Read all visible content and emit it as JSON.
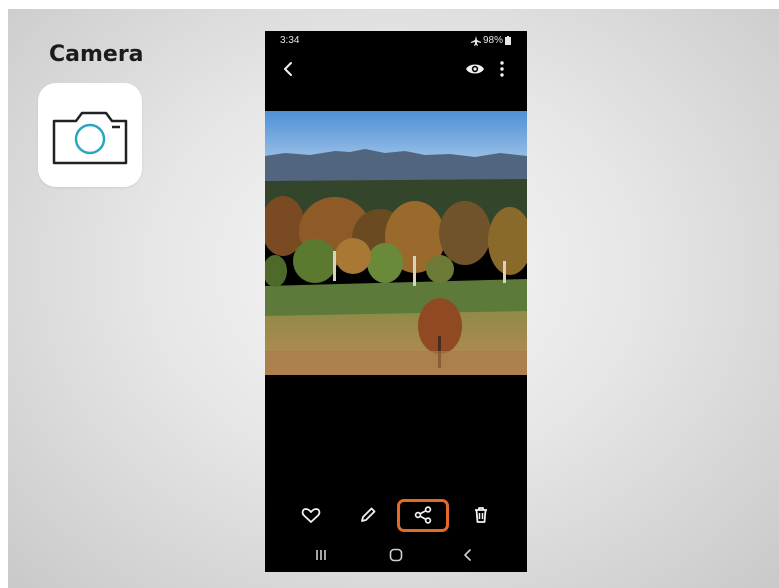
{
  "app": {
    "title": "Camera"
  },
  "status_bar": {
    "time": "3:34",
    "battery": "98%"
  },
  "colors": {
    "highlight": "#e36a2b",
    "icon_accent": "#2aa7c0"
  },
  "icons": {
    "camera": "camera-icon",
    "back": "back-arrow-icon",
    "view": "eye-icon",
    "more": "more-vertical-icon",
    "favorite": "heart-icon",
    "edit": "pencil-icon",
    "share": "share-icon",
    "delete": "trash-icon",
    "recents": "recents-icon",
    "home": "home-icon",
    "nav_back": "nav-back-icon"
  }
}
